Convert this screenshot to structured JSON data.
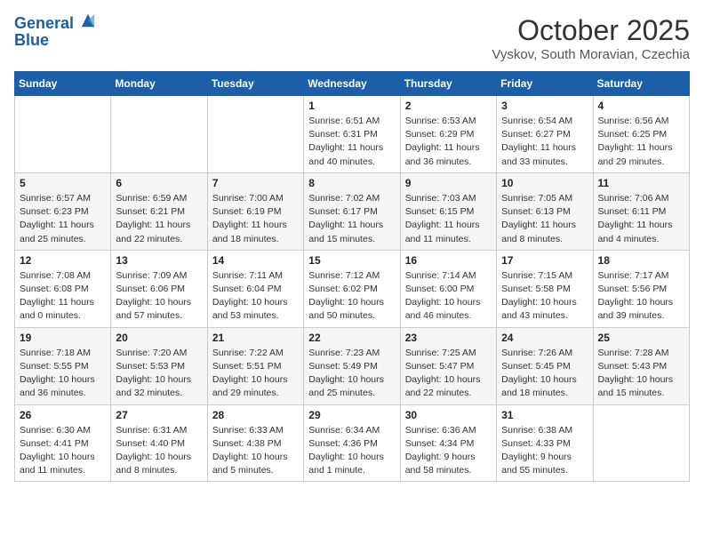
{
  "header": {
    "logo_line1": "General",
    "logo_line2": "Blue",
    "month_title": "October 2025",
    "location": "Vyskov, South Moravian, Czechia"
  },
  "weekdays": [
    "Sunday",
    "Monday",
    "Tuesday",
    "Wednesday",
    "Thursday",
    "Friday",
    "Saturday"
  ],
  "weeks": [
    [
      {
        "day": "",
        "info": ""
      },
      {
        "day": "",
        "info": ""
      },
      {
        "day": "",
        "info": ""
      },
      {
        "day": "1",
        "info": "Sunrise: 6:51 AM\nSunset: 6:31 PM\nDaylight: 11 hours and 40 minutes."
      },
      {
        "day": "2",
        "info": "Sunrise: 6:53 AM\nSunset: 6:29 PM\nDaylight: 11 hours and 36 minutes."
      },
      {
        "day": "3",
        "info": "Sunrise: 6:54 AM\nSunset: 6:27 PM\nDaylight: 11 hours and 33 minutes."
      },
      {
        "day": "4",
        "info": "Sunrise: 6:56 AM\nSunset: 6:25 PM\nDaylight: 11 hours and 29 minutes."
      }
    ],
    [
      {
        "day": "5",
        "info": "Sunrise: 6:57 AM\nSunset: 6:23 PM\nDaylight: 11 hours and 25 minutes."
      },
      {
        "day": "6",
        "info": "Sunrise: 6:59 AM\nSunset: 6:21 PM\nDaylight: 11 hours and 22 minutes."
      },
      {
        "day": "7",
        "info": "Sunrise: 7:00 AM\nSunset: 6:19 PM\nDaylight: 11 hours and 18 minutes."
      },
      {
        "day": "8",
        "info": "Sunrise: 7:02 AM\nSunset: 6:17 PM\nDaylight: 11 hours and 15 minutes."
      },
      {
        "day": "9",
        "info": "Sunrise: 7:03 AM\nSunset: 6:15 PM\nDaylight: 11 hours and 11 minutes."
      },
      {
        "day": "10",
        "info": "Sunrise: 7:05 AM\nSunset: 6:13 PM\nDaylight: 11 hours and 8 minutes."
      },
      {
        "day": "11",
        "info": "Sunrise: 7:06 AM\nSunset: 6:11 PM\nDaylight: 11 hours and 4 minutes."
      }
    ],
    [
      {
        "day": "12",
        "info": "Sunrise: 7:08 AM\nSunset: 6:08 PM\nDaylight: 11 hours and 0 minutes."
      },
      {
        "day": "13",
        "info": "Sunrise: 7:09 AM\nSunset: 6:06 PM\nDaylight: 10 hours and 57 minutes."
      },
      {
        "day": "14",
        "info": "Sunrise: 7:11 AM\nSunset: 6:04 PM\nDaylight: 10 hours and 53 minutes."
      },
      {
        "day": "15",
        "info": "Sunrise: 7:12 AM\nSunset: 6:02 PM\nDaylight: 10 hours and 50 minutes."
      },
      {
        "day": "16",
        "info": "Sunrise: 7:14 AM\nSunset: 6:00 PM\nDaylight: 10 hours and 46 minutes."
      },
      {
        "day": "17",
        "info": "Sunrise: 7:15 AM\nSunset: 5:58 PM\nDaylight: 10 hours and 43 minutes."
      },
      {
        "day": "18",
        "info": "Sunrise: 7:17 AM\nSunset: 5:56 PM\nDaylight: 10 hours and 39 minutes."
      }
    ],
    [
      {
        "day": "19",
        "info": "Sunrise: 7:18 AM\nSunset: 5:55 PM\nDaylight: 10 hours and 36 minutes."
      },
      {
        "day": "20",
        "info": "Sunrise: 7:20 AM\nSunset: 5:53 PM\nDaylight: 10 hours and 32 minutes."
      },
      {
        "day": "21",
        "info": "Sunrise: 7:22 AM\nSunset: 5:51 PM\nDaylight: 10 hours and 29 minutes."
      },
      {
        "day": "22",
        "info": "Sunrise: 7:23 AM\nSunset: 5:49 PM\nDaylight: 10 hours and 25 minutes."
      },
      {
        "day": "23",
        "info": "Sunrise: 7:25 AM\nSunset: 5:47 PM\nDaylight: 10 hours and 22 minutes."
      },
      {
        "day": "24",
        "info": "Sunrise: 7:26 AM\nSunset: 5:45 PM\nDaylight: 10 hours and 18 minutes."
      },
      {
        "day": "25",
        "info": "Sunrise: 7:28 AM\nSunset: 5:43 PM\nDaylight: 10 hours and 15 minutes."
      }
    ],
    [
      {
        "day": "26",
        "info": "Sunrise: 6:30 AM\nSunset: 4:41 PM\nDaylight: 10 hours and 11 minutes."
      },
      {
        "day": "27",
        "info": "Sunrise: 6:31 AM\nSunset: 4:40 PM\nDaylight: 10 hours and 8 minutes."
      },
      {
        "day": "28",
        "info": "Sunrise: 6:33 AM\nSunset: 4:38 PM\nDaylight: 10 hours and 5 minutes."
      },
      {
        "day": "29",
        "info": "Sunrise: 6:34 AM\nSunset: 4:36 PM\nDaylight: 10 hours and 1 minute."
      },
      {
        "day": "30",
        "info": "Sunrise: 6:36 AM\nSunset: 4:34 PM\nDaylight: 9 hours and 58 minutes."
      },
      {
        "day": "31",
        "info": "Sunrise: 6:38 AM\nSunset: 4:33 PM\nDaylight: 9 hours and 55 minutes."
      },
      {
        "day": "",
        "info": ""
      }
    ]
  ]
}
